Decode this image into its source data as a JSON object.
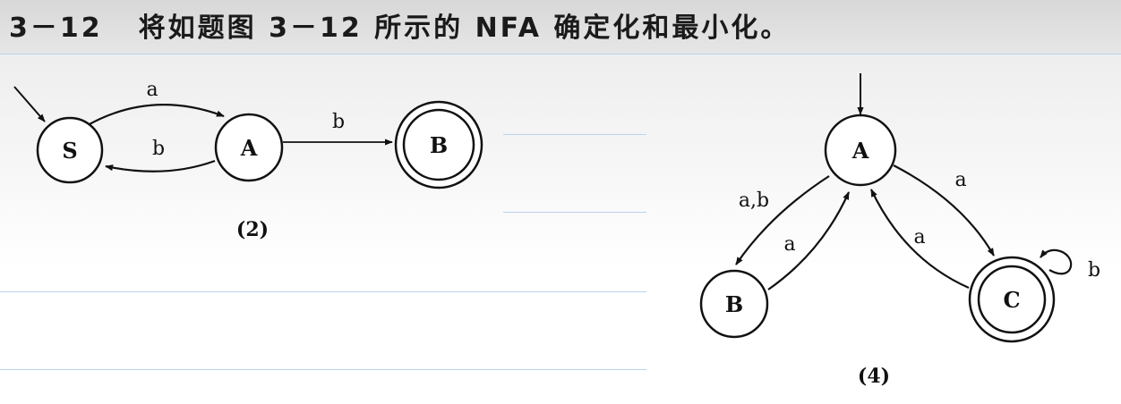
{
  "header": {
    "problem_number": "3－12",
    "problem_text": "将如题图 3－12 所示的 NFA 确定化和最小化。"
  },
  "figure2": {
    "caption": "(2)",
    "states": [
      {
        "id": "S",
        "label": "S",
        "start": true,
        "accepting": false
      },
      {
        "id": "A",
        "label": "A",
        "start": false,
        "accepting": false
      },
      {
        "id": "B",
        "label": "B",
        "start": false,
        "accepting": true
      }
    ],
    "transitions": [
      {
        "from": "S",
        "to": "A",
        "label": "a"
      },
      {
        "from": "A",
        "to": "S",
        "label": "b"
      },
      {
        "from": "A",
        "to": "B",
        "label": "b"
      }
    ]
  },
  "figure4": {
    "caption": "(4)",
    "states": [
      {
        "id": "A",
        "label": "A",
        "start": true,
        "accepting": false
      },
      {
        "id": "B",
        "label": "B",
        "start": false,
        "accepting": false
      },
      {
        "id": "C",
        "label": "C",
        "start": false,
        "accepting": true
      }
    ],
    "transitions": [
      {
        "from": "A",
        "to": "B",
        "label": "a,b"
      },
      {
        "from": "B",
        "to": "A",
        "label": "a"
      },
      {
        "from": "A",
        "to": "C",
        "label": "a"
      },
      {
        "from": "C",
        "to": "A",
        "label": "a"
      },
      {
        "from": "C",
        "to": "C",
        "label": "b"
      }
    ]
  }
}
